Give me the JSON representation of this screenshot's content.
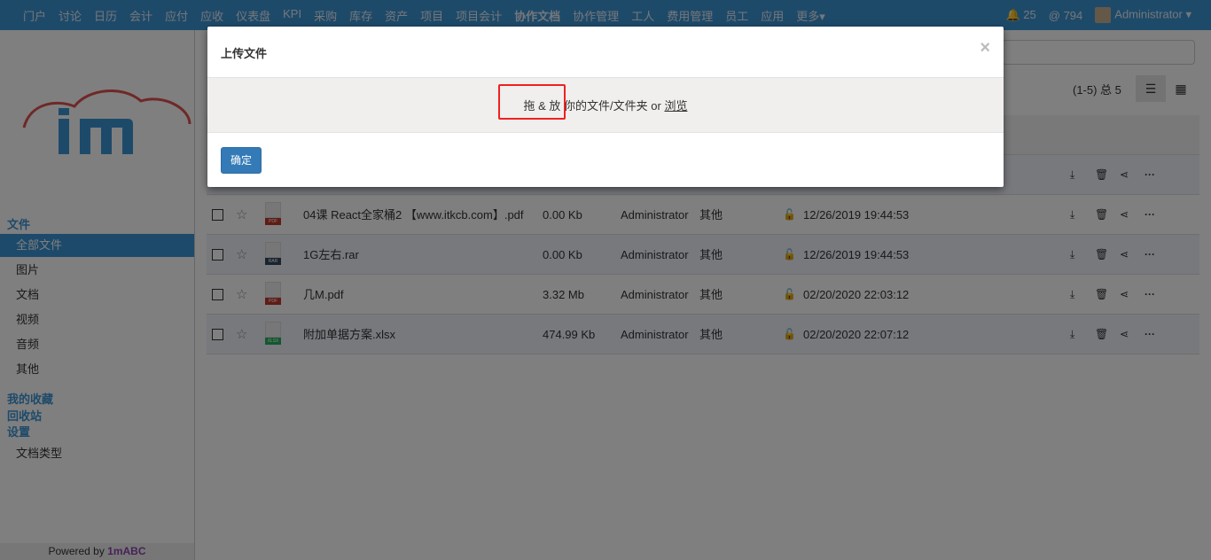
{
  "topnav": {
    "items": [
      "门户",
      "讨论",
      "日历",
      "会计",
      "应付",
      "应收",
      "仪表盘",
      "KPI",
      "采购",
      "库存",
      "资产",
      "项目",
      "项目会计",
      "协作文档",
      "协作管理",
      "工人",
      "费用管理",
      "员工",
      "应用",
      "更多▾"
    ],
    "bold_index": 13,
    "notifications": "25",
    "mentions": "794",
    "user": "Administrator ▾"
  },
  "sidebar": {
    "section_files": "文件",
    "items": [
      "全部文件",
      "图片",
      "文档",
      "视频",
      "音频",
      "其他"
    ],
    "active": "全部文件",
    "favorites": "我的收藏",
    "recycle": "回收站",
    "settings": "设置",
    "settings_items": [
      "文档类型"
    ],
    "powered_prefix": "Powered by ",
    "powered_brand": "1mABC"
  },
  "toolbar": {
    "count": "(1-5) 总 5",
    "list_view_icon": "list-icon",
    "grid_view_icon": "grid-icon"
  },
  "files": [
    {
      "name": "",
      "size": "",
      "owner": "",
      "type": "",
      "date": "",
      "kind": "PDF"
    },
    {
      "name": "04课 React全家桶2 【www.itkcb.com】.pdf",
      "size": "0.00 Kb",
      "owner": "Administrator",
      "type": "其他",
      "date": "12/26/2019 19:44:53",
      "kind": "PDF"
    },
    {
      "name": "1G左右.rar",
      "size": "0.00 Kb",
      "owner": "Administrator",
      "type": "其他",
      "date": "12/26/2019 19:44:53",
      "kind": "RAR"
    },
    {
      "name": "几M.pdf",
      "size": "3.32 Mb",
      "owner": "Administrator",
      "type": "其他",
      "date": "02/20/2020 22:03:12",
      "kind": "PDF"
    },
    {
      "name": "附加单据方案.xlsx",
      "size": "474.99 Kb",
      "owner": "Administrator",
      "type": "其他",
      "date": "02/20/2020 22:07:12",
      "kind": "XLSX"
    }
  ],
  "modal": {
    "title": "上传文件",
    "close": "×",
    "drop_text": "拖 & 放 你的文件/文件夹 or ",
    "browse": "浏览",
    "ok": "确定"
  },
  "colors": {
    "brand": "#3c94d4",
    "button": "#337ab7",
    "highlight": "#f02020",
    "pdf": "#c0392b",
    "rar": "#34495e",
    "xlsx": "#27ae60"
  }
}
